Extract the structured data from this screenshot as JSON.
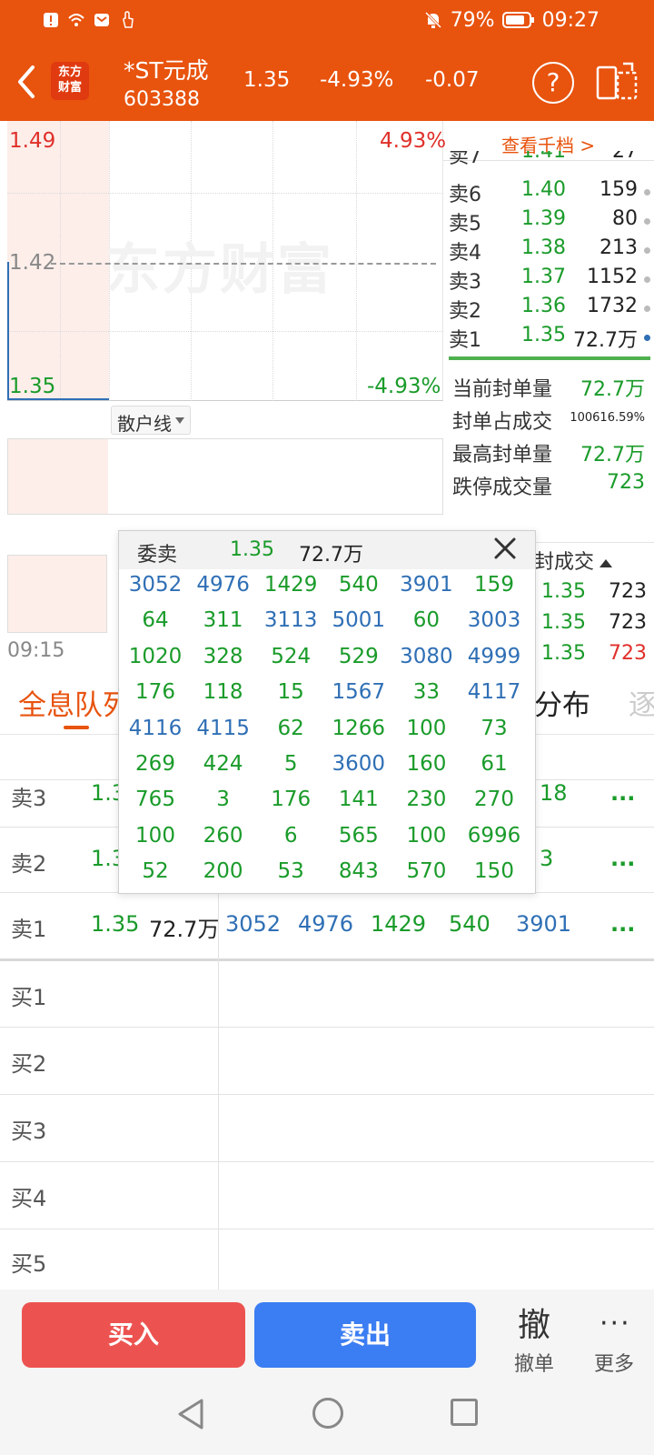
{
  "status_bar": {
    "icons": [
      "alert-icon",
      "wifi-icon",
      "mail-icon",
      "touch-icon"
    ],
    "right_icons": [
      "mute-bell-icon",
      "battery-icon"
    ],
    "battery": "79%",
    "time": "09:27"
  },
  "header": {
    "logo_line1": "东方",
    "logo_line2": "财富",
    "name": "*ST元成",
    "code": "603388",
    "price": "1.35",
    "change_pct": "-4.93%",
    "change": "-0.07",
    "help": "?"
  },
  "chart": {
    "high_price": "1.49",
    "high_pct": "4.93%",
    "mid_price": "1.42",
    "low_price": "1.35",
    "low_pct": "-4.93%",
    "watermark": "东方财富",
    "indicator_dropdown": "散户线",
    "start_time": "09:15"
  },
  "order_book": {
    "depth_link": "查看千档 >",
    "asks": [
      {
        "label": "卖7",
        "price": "1.41",
        "volume": "27"
      },
      {
        "label": "卖6",
        "price": "1.40",
        "volume": "159"
      },
      {
        "label": "卖5",
        "price": "1.39",
        "volume": "80"
      },
      {
        "label": "卖4",
        "price": "1.38",
        "volume": "213"
      },
      {
        "label": "卖3",
        "price": "1.37",
        "volume": "1152"
      },
      {
        "label": "卖2",
        "price": "1.36",
        "volume": "1732"
      },
      {
        "label": "卖1",
        "price": "1.35",
        "volume": "72.7万"
      }
    ]
  },
  "limit_stats": [
    {
      "label": "当前封单量",
      "value": "72.7万"
    },
    {
      "label": "封单占成交",
      "value": "100616.59%"
    },
    {
      "label": "最高封单量",
      "value": "72.7万"
    },
    {
      "label": "跌停成交量",
      "value": "723"
    }
  ],
  "trades": {
    "header": "封成交",
    "rows": [
      {
        "price": "1.35",
        "volume": "723"
      },
      {
        "price": "1.35",
        "volume": "723"
      },
      {
        "price": "1.35",
        "volume": "723"
      }
    ]
  },
  "tabs": {
    "active": "全息队列",
    "distribution": "分布",
    "next": "逐"
  },
  "queue": {
    "rows": [
      {
        "label": "卖3",
        "price": "1.3",
        "tail": "18"
      },
      {
        "label": "卖2",
        "price": "1.3",
        "tail": "3"
      },
      {
        "label": "卖1",
        "price": "1.35",
        "volume": "72.7万",
        "orders": [
          "3052",
          "4976",
          "1429",
          "540",
          "3901"
        ]
      },
      {
        "label": "买1"
      },
      {
        "label": "买2"
      },
      {
        "label": "买3"
      },
      {
        "label": "买4"
      },
      {
        "label": "买5"
      }
    ],
    "more": "..."
  },
  "popup": {
    "title": "委卖",
    "price": "1.35",
    "volume": "72.7万",
    "cells": [
      "3052",
      "4976",
      "1429",
      "540",
      "3901",
      "159",
      "64",
      "311",
      "3113",
      "5001",
      "60",
      "3003",
      "1020",
      "328",
      "524",
      "529",
      "3080",
      "4999",
      "176",
      "118",
      "15",
      "1567",
      "33",
      "4117",
      "4116",
      "4115",
      "62",
      "1266",
      "100",
      "73",
      "269",
      "424",
      "5",
      "3600",
      "160",
      "61",
      "765",
      "3",
      "176",
      "141",
      "230",
      "270",
      "100",
      "260",
      "6",
      "565",
      "100",
      "6996",
      "52",
      "200",
      "53",
      "843",
      "570",
      "150"
    ],
    "cell_colors": [
      "blue",
      "blue",
      "green",
      "green",
      "blue",
      "green",
      "green",
      "green",
      "blue",
      "blue",
      "green",
      "blue",
      "green",
      "green",
      "green",
      "green",
      "blue",
      "blue",
      "green",
      "green",
      "green",
      "blue",
      "green",
      "blue",
      "blue",
      "blue",
      "green",
      "green",
      "green",
      "green",
      "green",
      "green",
      "green",
      "blue",
      "green",
      "green",
      "green",
      "green",
      "green",
      "green",
      "green",
      "green",
      "green",
      "green",
      "green",
      "green",
      "green",
      "green",
      "green",
      "green",
      "green",
      "green",
      "green",
      "green"
    ]
  },
  "actions": {
    "buy": "买入",
    "sell": "卖出",
    "cancel_icon": "撤",
    "cancel": "撤单",
    "more_icon": "···",
    "more": "更多"
  },
  "colors": {
    "brand": "#e8530e",
    "up": "#e0302a",
    "down": "#1a9b2a",
    "blue": "#2f6fb5"
  }
}
